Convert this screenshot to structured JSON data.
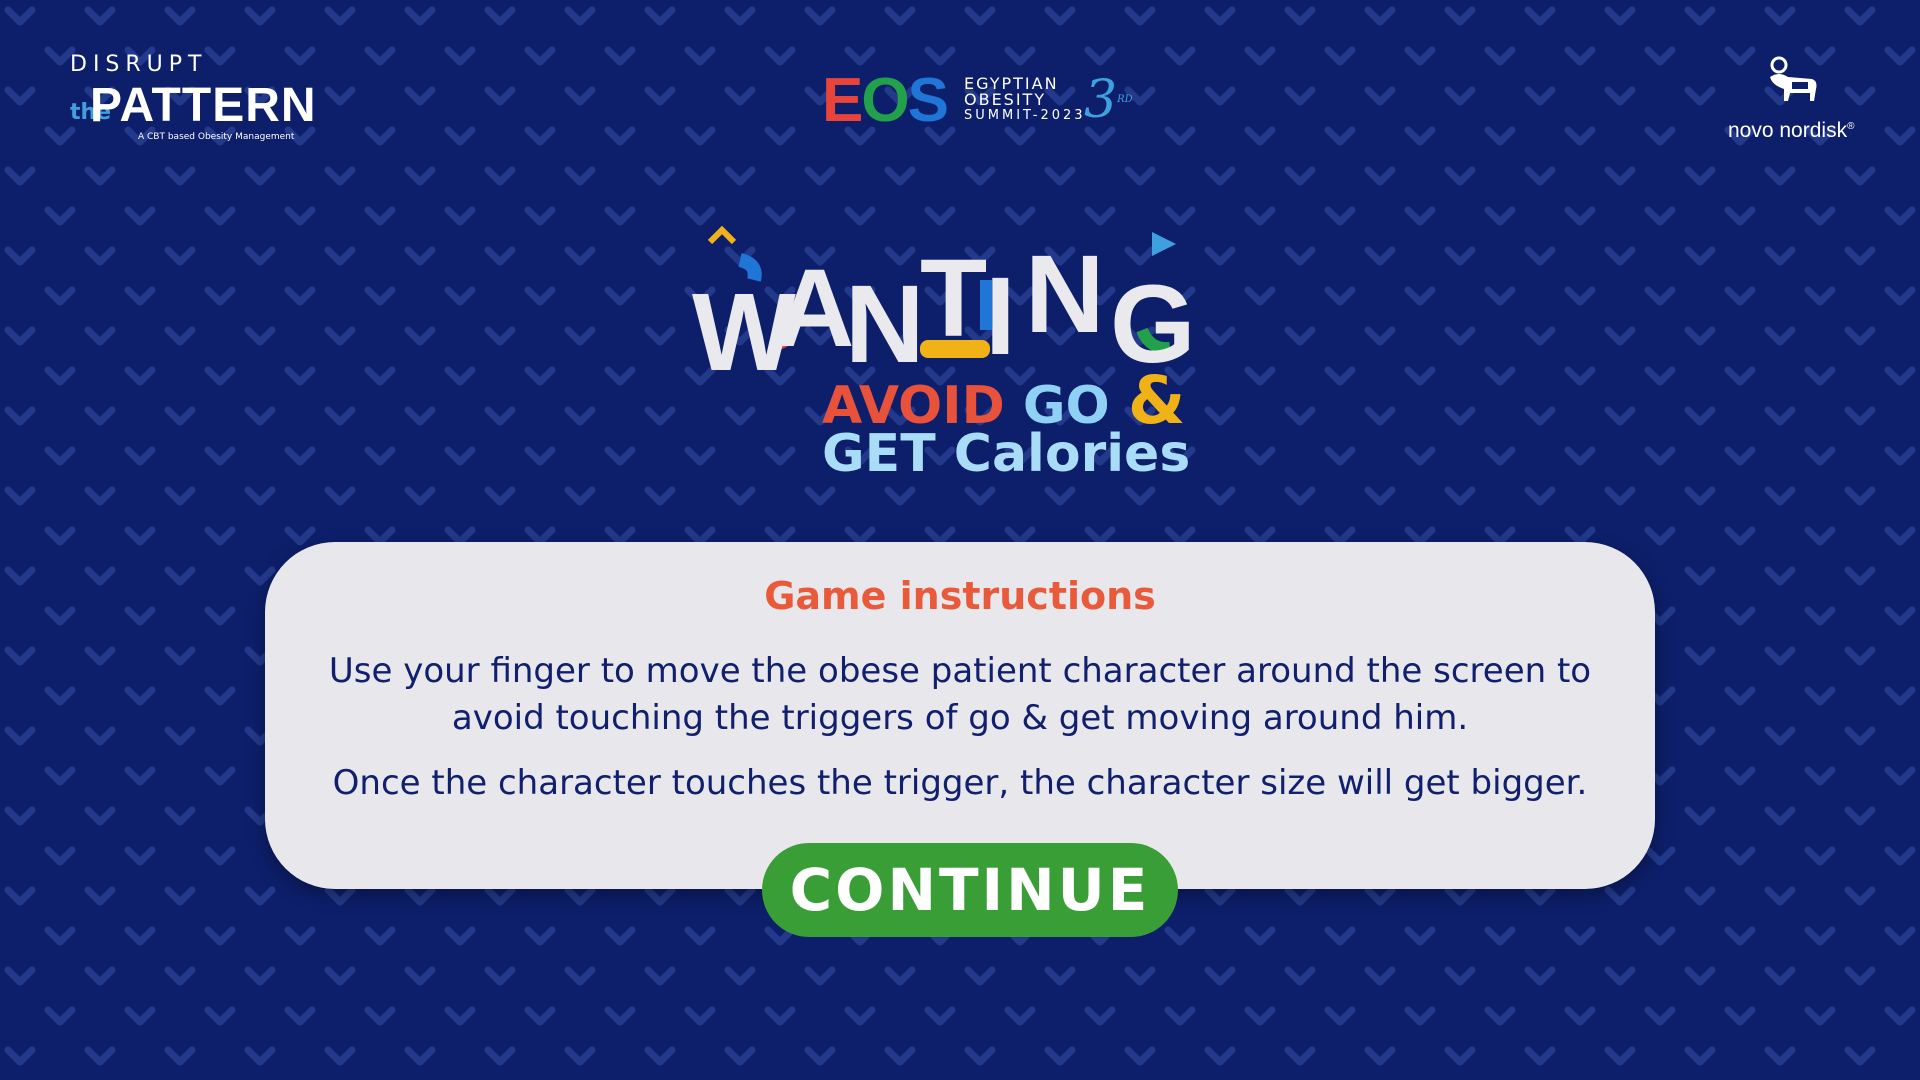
{
  "header": {
    "disrupt_logo": {
      "top": "DISRUPT",
      "the": "the",
      "pattern": "PATTERN",
      "tagline": "A CBT based Obesity Management"
    },
    "eos_logo": {
      "letters": "EOS",
      "line1": "EGYPTIAN",
      "line2": "OBESITY",
      "line3": "SUMMIT-2023",
      "edition": "3",
      "edition_suffix": "RD"
    },
    "novo_logo": {
      "name": "novo nordisk",
      "mark": "®",
      "icon": "apis-bull-icon"
    }
  },
  "title": {
    "main": "WANTING",
    "avoid": "AVOID",
    "go": "GO",
    "amp": "&",
    "line2": "GET Calories"
  },
  "instructions": {
    "heading": "Game instructions",
    "p1": "Use your finger to move the obese patient character around the screen to avoid touching the triggers of go & get moving around him.",
    "p2": "Once the character touches the trigger, the character size will get bigger."
  },
  "buttons": {
    "continue": "CONTINUE"
  },
  "colors": {
    "background": "#0d1f6b",
    "pattern": "#233a8c",
    "accent_red": "#e8523a",
    "accent_green": "#3a9e36",
    "accent_yellow": "#f0b217",
    "accent_blue": "#1f76d6",
    "text_dark": "#11206e"
  }
}
